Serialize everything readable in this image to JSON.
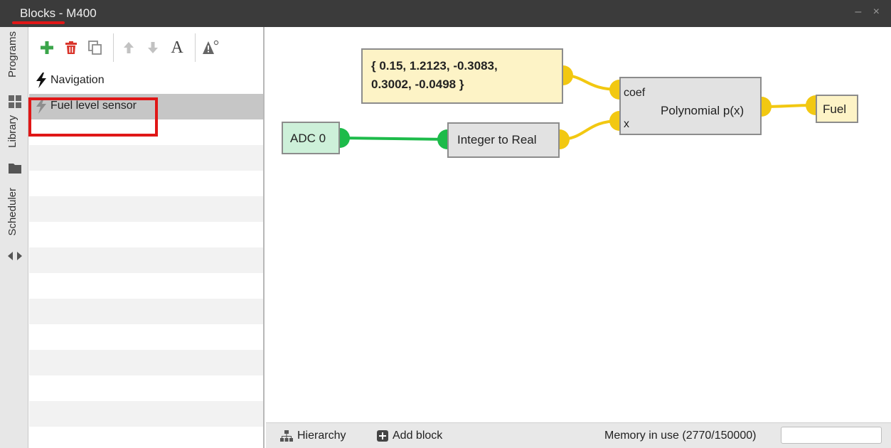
{
  "window": {
    "title": "Blocks - M400",
    "controls": "– ×"
  },
  "vertical_tabs": [
    {
      "label": "Programs",
      "icon": "grid-icon"
    },
    {
      "label": "Library",
      "icon": "folder-icon"
    },
    {
      "label": "Scheduler",
      "icon": "arrows-icon"
    }
  ],
  "toolbar": {
    "add": "plus-icon",
    "delete": "trash-icon",
    "copy": "copy-icon",
    "up": "arrow-up-icon",
    "down": "arrow-down-icon",
    "rename": "A",
    "warnings": "A⁰"
  },
  "programs": [
    {
      "label": "Navigation",
      "icon": "bolt-icon"
    },
    {
      "label": "Fuel level sensor",
      "icon": "bolt-icon",
      "selected": true
    }
  ],
  "canvas": {
    "coef_block": {
      "line1": "{ 0.15, 1.2123, -0.3083,",
      "line2": "0.3002, -0.0498 }"
    },
    "adc_block": "ADC 0",
    "int_to_real_block": "Integer to Real",
    "poly_block": {
      "name": "Polynomial  p(x)",
      "in_coef": "coef",
      "in_x": "x"
    },
    "fuel_block": "Fuel",
    "colors": {
      "yellow_wire": "#f2c811",
      "green_wire": "#1dbb4a",
      "const_fill": "#fdf3c6",
      "adc_fill": "#cdf0d9"
    }
  },
  "statusbar": {
    "hierarchy": "Hierarchy",
    "add_block": "Add block",
    "memory": "Memory in use (2770/150000)"
  },
  "accent": "#e01717"
}
